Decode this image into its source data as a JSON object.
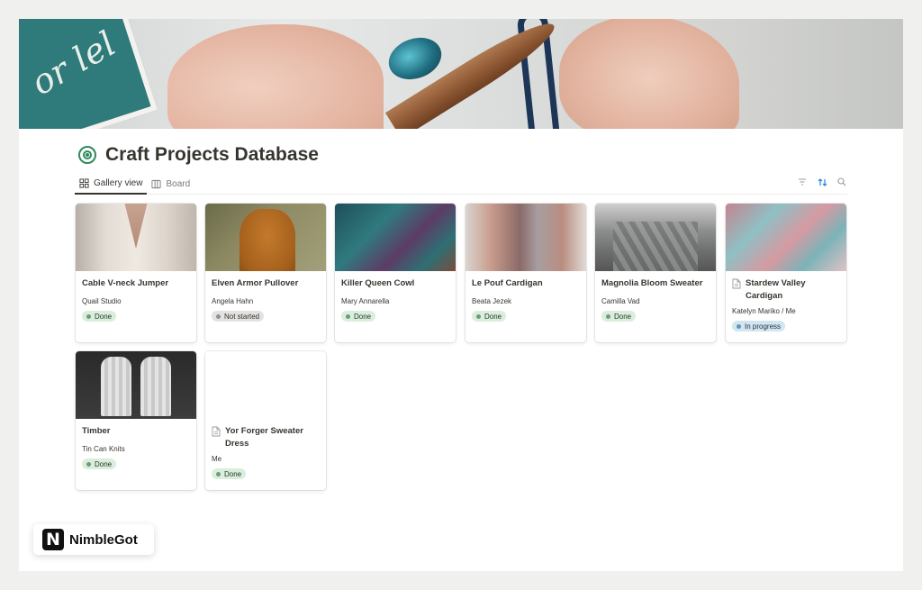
{
  "cover": {
    "book_text": "or lel"
  },
  "page": {
    "title": "Craft Projects Database",
    "icon": "target-icon"
  },
  "tabs": [
    {
      "label": "Gallery view",
      "icon": "grid-icon",
      "active": true
    },
    {
      "label": "Board",
      "icon": "board-icon",
      "active": false
    }
  ],
  "toolbar": {
    "icons": [
      "filter-icon",
      "sort-icon",
      "search-icon"
    ],
    "accent": "#2383e2"
  },
  "cards": [
    {
      "title": "Cable V-neck Jumper",
      "author": "Quail Studio",
      "status": "Done",
      "status_kind": "done",
      "doc_icon": false
    },
    {
      "title": "Elven Armor Pullover",
      "author": "Angela Hahn",
      "status": "Not started",
      "status_kind": "notstarted",
      "doc_icon": false
    },
    {
      "title": "Killer Queen Cowl",
      "author": "Mary Annarella",
      "status": "Done",
      "status_kind": "done",
      "doc_icon": false
    },
    {
      "title": "Le Pouf Cardigan",
      "author": "Beata Jezek",
      "status": "Done",
      "status_kind": "done",
      "doc_icon": false
    },
    {
      "title": "Magnolia Bloom Sweater",
      "author": "Camilla Vad",
      "status": "Done",
      "status_kind": "done",
      "doc_icon": false
    },
    {
      "title": "Stardew Valley Cardigan",
      "author": "Katelyn Mariko / Me",
      "status": "In progress",
      "status_kind": "progress",
      "doc_icon": true
    },
    {
      "title": "Timber",
      "author": "Tin Can Knits",
      "status": "Done",
      "status_kind": "done",
      "doc_icon": false
    },
    {
      "title": "Yor Forger Sweater Dress",
      "author": "Me",
      "status": "Done",
      "status_kind": "done",
      "doc_icon": true
    }
  ],
  "colors": {
    "done_bg": "#dbeddb",
    "not_started_bg": "#e3e2e0",
    "in_progress_bg": "#d3e5ef",
    "title_icon": "#2f8a5a"
  },
  "brand": {
    "name": "NimbleGot",
    "logo_letter": "N"
  }
}
